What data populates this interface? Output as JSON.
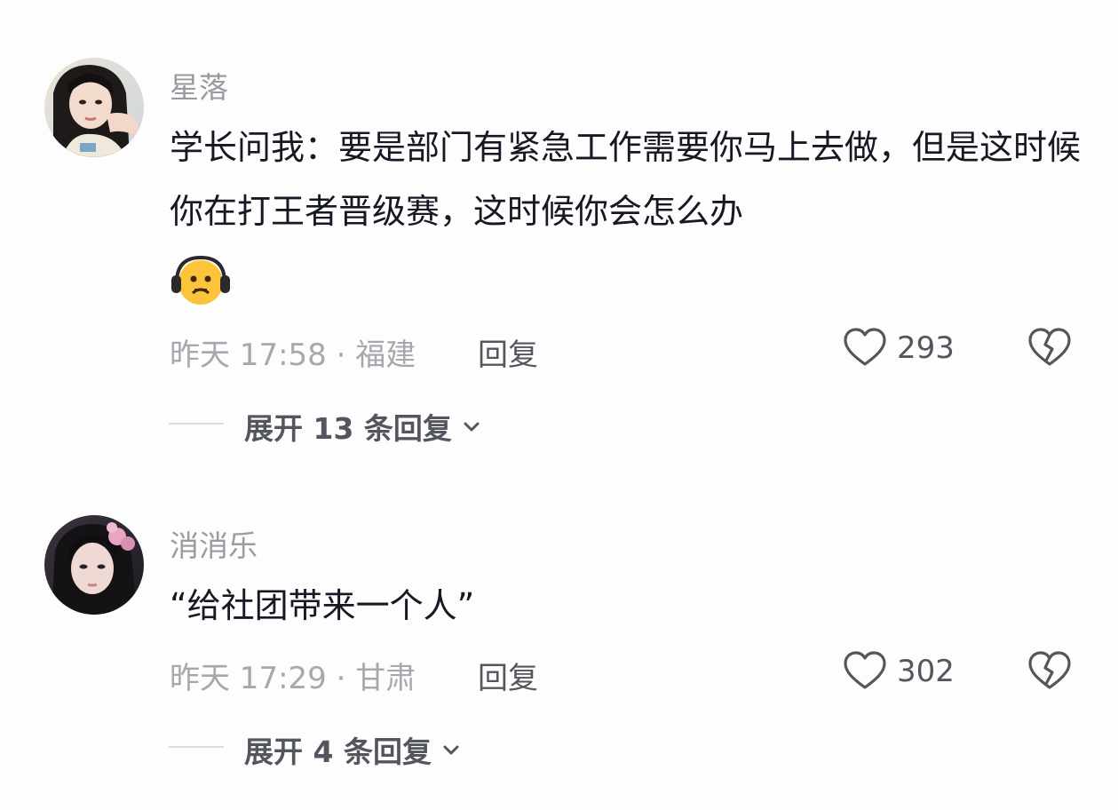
{
  "comments": [
    {
      "username": "星落",
      "text": "学长问我：要是部门有紧急工作需要你马上去做，但是这时候你在打王者晋级赛，这时候你会怎么办",
      "emoji": "headphones-sad-face-emoji",
      "meta": "昨天 17:58 · 福建",
      "reply_label": "回复",
      "likes": "293",
      "expand_label": "展开 13 条回复"
    },
    {
      "username": "消消乐",
      "text": "“给社团带来一个人”",
      "meta": "昨天 17:29 · 甘肃",
      "reply_label": "回复",
      "likes": "302",
      "expand_label": "展开 4 条回复"
    }
  ],
  "icons": {
    "like": "heart-outline-icon",
    "dislike": "broken-heart-icon",
    "expand": "chevron-down-icon"
  },
  "colors": {
    "background": "#fdfdfd",
    "text": "#161823",
    "secondary": "#a7a8ad",
    "action": "#54565e"
  }
}
